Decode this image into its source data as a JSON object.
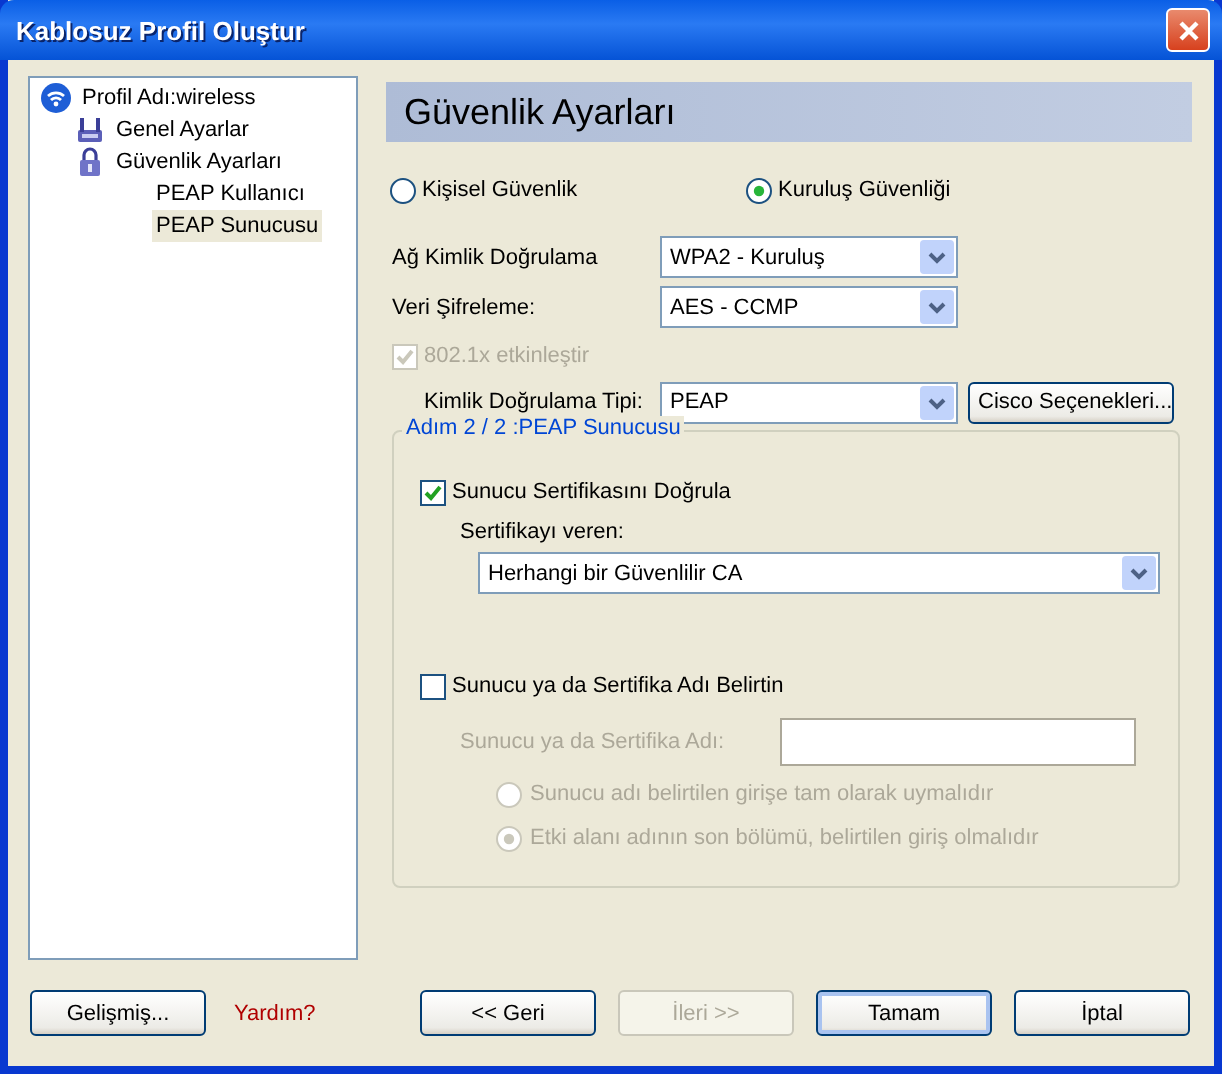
{
  "window": {
    "title": "Kablosuz Profil Oluştur"
  },
  "tree": [
    {
      "label": "Profil Adı:wireless",
      "selected": false,
      "children": [
        {
          "label": "Genel Ayarlar",
          "selected": false
        },
        {
          "label": "Güvenlik Ayarları",
          "selected": false,
          "children": [
            {
              "label": "PEAP Kullanıcı",
              "selected": false
            },
            {
              "label": "PEAP Sunucusu",
              "selected": true
            }
          ]
        }
      ]
    }
  ],
  "header": {
    "title": "Güvenlik Ayarları"
  },
  "security_mode": [
    {
      "label": "Kişisel Güvenlik",
      "selected": false
    },
    {
      "label": "Kuruluş Güvenliği",
      "selected": true
    }
  ],
  "fields": [
    {
      "label": "Ağ Kimlik Doğrulama",
      "value": "WPA2 - Kuruluş"
    },
    {
      "label": "Veri Şifreleme:",
      "value": "AES - CCMP"
    }
  ],
  "enable_8021x": {
    "label": "802.1x etkinleştir",
    "checked": true,
    "disabled": true
  },
  "auth_type": {
    "label": "Kimlik Doğrulama Tipi:",
    "value": "PEAP",
    "button": "Cisco Seçenekleri..."
  },
  "group": {
    "legend": "Adım 2 / 2 :PEAP Sunucusu",
    "verify_cert": {
      "label": "Sunucu Sertifikasını Doğrula",
      "checked": true
    },
    "issuer": {
      "label": "Sertifikayı veren:",
      "value": "Herhangi bir Güvenlilir CA"
    },
    "specify_name": {
      "label": "Sunucu ya da Sertifika Adı Belirtin",
      "checked": false
    },
    "name_field": {
      "label": "Sunucu ya da Sertifika Adı:",
      "disabled": true
    },
    "match_options": [
      {
        "label": "Sunucu adı belirtilen girişe tam olarak uymalıdır",
        "selected": false,
        "disabled": true
      },
      {
        "label": "Etki alanı adının son bölümü, belirtilen giriş olmalıdır",
        "selected": true,
        "disabled": true
      }
    ]
  },
  "footer": {
    "left": [
      {
        "label": "Gelişmiş...",
        "kind": "button"
      },
      {
        "label": "Yardım?",
        "kind": "link"
      }
    ],
    "buttons": [
      {
        "label": "<< Geri",
        "disabled": false,
        "default": false
      },
      {
        "label": "İleri >>",
        "disabled": true,
        "default": false
      },
      {
        "label": "Tamam",
        "disabled": false,
        "default": true
      },
      {
        "label": "İptal",
        "disabled": false,
        "default": false
      }
    ]
  }
}
